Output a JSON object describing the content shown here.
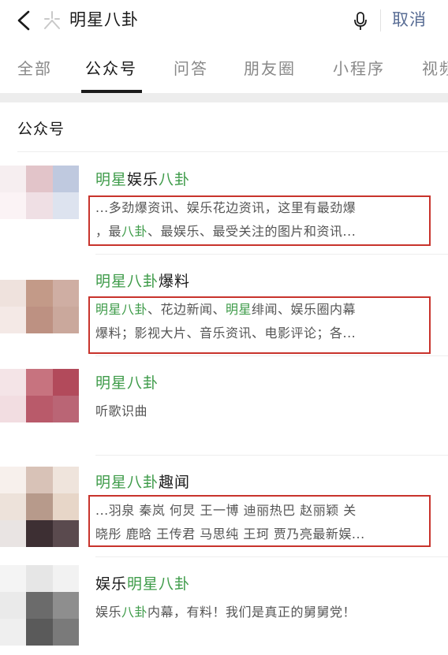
{
  "search": {
    "query": "明星八卦",
    "cancel_label": "取消"
  },
  "tabs": [
    {
      "label": "全部",
      "active": false
    },
    {
      "label": "公众号",
      "active": true
    },
    {
      "label": "问答",
      "active": false
    },
    {
      "label": "朋友圈",
      "active": false
    },
    {
      "label": "小程序",
      "active": false
    },
    {
      "label": "视频",
      "active": false
    }
  ],
  "section": {
    "title": "公众号"
  },
  "colors": {
    "highlight": "#3e9b49",
    "annotation_box": "#c8332c",
    "cancel": "#586c94"
  },
  "results": [
    {
      "name_parts": [
        {
          "t": "明星",
          "hl": true
        },
        {
          "t": "娱乐",
          "hl": false
        },
        {
          "t": "八卦",
          "hl": true
        }
      ],
      "desc_lines": [
        [
          {
            "t": "...多劲爆资讯、娱乐花边资讯，这里有最劲爆",
            "hl": false
          }
        ],
        [
          {
            "t": "，最",
            "hl": false
          },
          {
            "t": "八卦",
            "hl": true
          },
          {
            "t": "、最娱乐、最受关注的图片和资讯...",
            "hl": false
          }
        ]
      ],
      "highlighted_box": true
    },
    {
      "name_parts": [
        {
          "t": "明星八卦",
          "hl": true
        },
        {
          "t": "爆料",
          "hl": false
        }
      ],
      "desc_lines": [
        [
          {
            "t": "明星八卦",
            "hl": true
          },
          {
            "t": "、花边新闻、",
            "hl": false
          },
          {
            "t": "明星",
            "hl": true
          },
          {
            "t": "绯闻、娱乐圈内幕",
            "hl": false
          }
        ],
        [
          {
            "t": "爆料；影视大片、音乐资讯、电影评论；各...",
            "hl": false
          }
        ]
      ],
      "highlighted_box": true
    },
    {
      "name_parts": [
        {
          "t": "明星八卦",
          "hl": true
        }
      ],
      "desc_lines": [
        [
          {
            "t": "听歌识曲",
            "hl": false
          }
        ]
      ],
      "highlighted_box": false
    },
    {
      "name_parts": [
        {
          "t": "明星八卦",
          "hl": true
        },
        {
          "t": "趣闻",
          "hl": false
        }
      ],
      "desc_lines": [
        [
          {
            "t": "...羽泉 秦岚 何炅 王一博 迪丽热巴 赵丽颖 关",
            "hl": false
          }
        ],
        [
          {
            "t": "晓彤 鹿晗 王传君 马思纯 王珂 贾乃亮最新娱...",
            "hl": false
          }
        ]
      ],
      "highlighted_box": true
    },
    {
      "name_parts": [
        {
          "t": "娱乐",
          "hl": false
        },
        {
          "t": "明星八卦",
          "hl": true
        }
      ],
      "desc_lines": [
        [
          {
            "t": "娱乐",
            "hl": false
          },
          {
            "t": "八卦",
            "hl": true
          },
          {
            "t": "内幕，有料！我们是真正的舅舅党！",
            "hl": false
          }
        ]
      ],
      "highlighted_box": false
    }
  ]
}
